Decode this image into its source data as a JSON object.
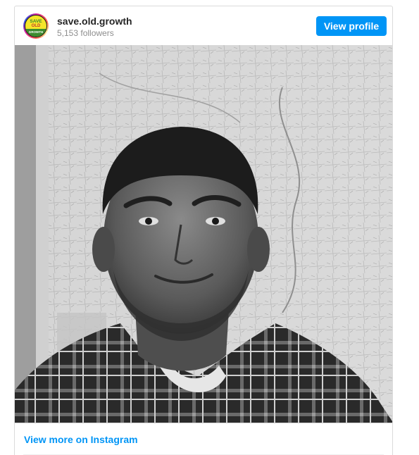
{
  "profile": {
    "username": "save.old.growth",
    "followers": "5,153 followers",
    "avatar": {
      "line1": "SAVE",
      "line2": "OLD",
      "line3": "GROWTH",
      "colors": {
        "background": "#f4e62a",
        "band": "#3c8a2e",
        "accent": "#c0392b"
      }
    }
  },
  "header": {
    "view_profile_label": "View profile"
  },
  "footer": {
    "view_more_label": "View more on Instagram"
  },
  "colors": {
    "primary_blue": "#0095f6",
    "border": "#dbdbdb",
    "muted_text": "#8e8e8e"
  }
}
